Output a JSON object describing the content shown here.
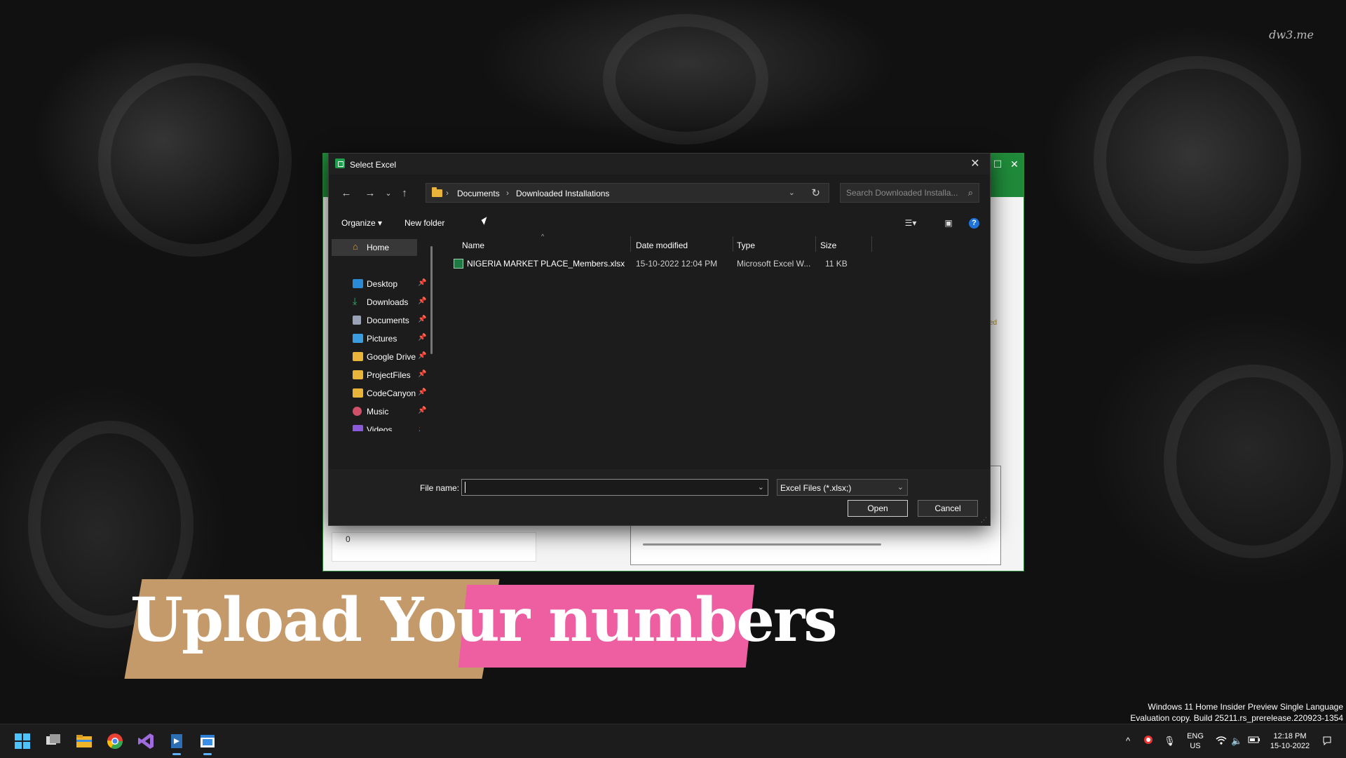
{
  "wallpaper": {
    "watermark": "dw3.me"
  },
  "background_app": {
    "lower_value": "0",
    "side_text": "ed"
  },
  "dialog": {
    "title": "Select Excel",
    "address": {
      "crumbs": [
        "Documents",
        "Downloaded Installations"
      ],
      "separator": "›"
    },
    "search_placeholder": "Search Downloaded Installa...",
    "toolbar": {
      "organize": "Organize ▾",
      "new_folder": "New folder"
    },
    "nav": [
      {
        "label": "Home",
        "icon": "home-icon",
        "pinned": false
      },
      {
        "label": "Desktop",
        "icon": "desktop-icon",
        "pinned": true
      },
      {
        "label": "Downloads",
        "icon": "download-icon",
        "pinned": true
      },
      {
        "label": "Documents",
        "icon": "documents-icon",
        "pinned": true
      },
      {
        "label": "Pictures",
        "icon": "pictures-icon",
        "pinned": true
      },
      {
        "label": "Google Drive",
        "icon": "folder-icon",
        "pinned": true
      },
      {
        "label": "ProjectFiles",
        "icon": "folder-icon",
        "pinned": true
      },
      {
        "label": "CodeCanyon",
        "icon": "folder-icon",
        "pinned": true
      },
      {
        "label": "Music",
        "icon": "music-icon",
        "pinned": true
      },
      {
        "label": "Videos",
        "icon": "videos-icon",
        "pinned": true
      }
    ],
    "columns": [
      "Name",
      "Date modified",
      "Type",
      "Size"
    ],
    "files": [
      {
        "name": "NIGERIA MARKET PLACE_Members.xlsx",
        "date": "15-10-2022 12:04 PM",
        "type": "Microsoft Excel W...",
        "size": "11 KB"
      }
    ],
    "file_name_label": "File name:",
    "file_name_value": "",
    "file_type": "Excel Files (*.xlsx;)",
    "open_label": "Open",
    "cancel_label": "Cancel"
  },
  "banner": {
    "text": "Upload Your numbers",
    "colors": {
      "left": "#c59a6b",
      "right": "#ee5fa2"
    }
  },
  "eval_watermark": {
    "line1": "Windows 11 Home Insider Preview Single Language",
    "line2": "Evaluation copy. Build 25211.rs_prerelease.220923-1354"
  },
  "taskbar": {
    "apps": [
      "windows-start-icon",
      "task-view-icon",
      "file-explorer-icon",
      "chrome-icon",
      "visual-studio-icon",
      "installer-icon",
      "active-app-icon"
    ],
    "lang_top": "ENG",
    "lang_bottom": "US",
    "time": "12:18 PM",
    "date": "15-10-2022"
  },
  "colors": {
    "accent_green": "#1f8b3a",
    "dialog_bg": "#1c1c1c",
    "help_blue": "#1e73d8"
  }
}
